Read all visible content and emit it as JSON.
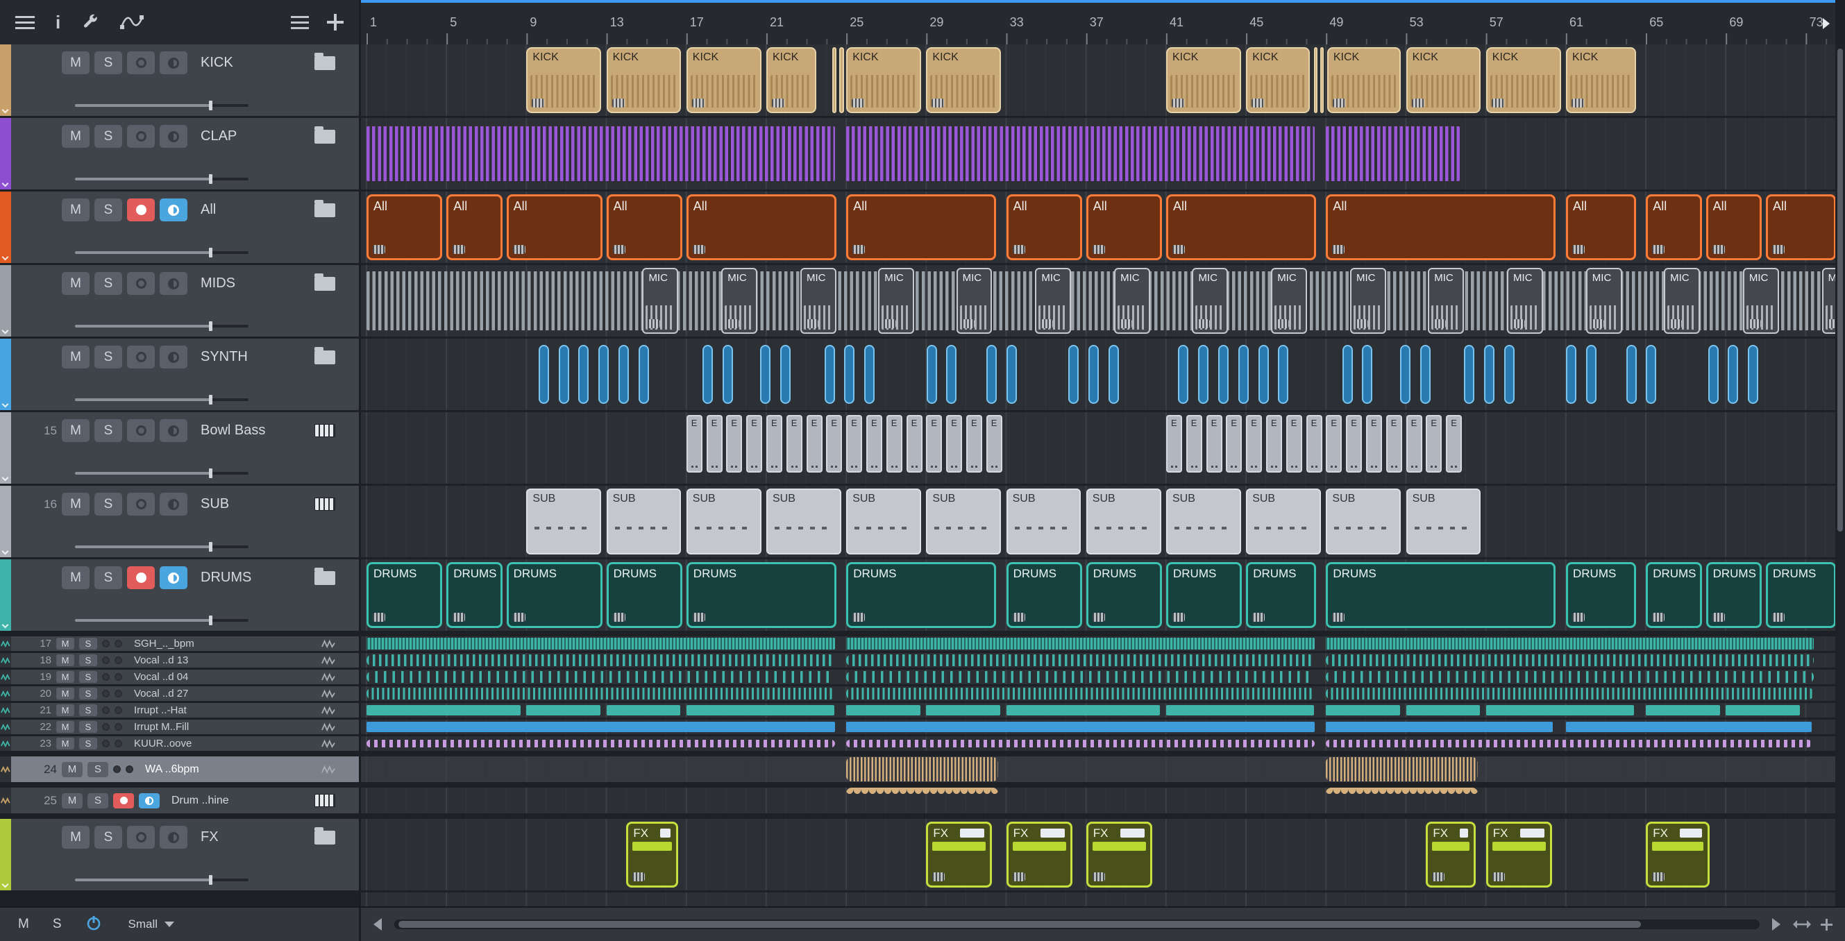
{
  "ui": {
    "mute": "M",
    "solo": "S"
  },
  "toolbar": {
    "info_label": "i",
    "icons": [
      "menu-icon",
      "info-icon",
      "wrench-icon",
      "automation-icon"
    ],
    "right_icons": [
      "track-list-icon",
      "add-track-icon"
    ]
  },
  "ruler": {
    "labels": [
      1,
      5,
      9,
      13,
      17,
      21,
      25,
      29,
      33,
      37,
      41,
      45,
      49,
      53,
      57,
      61,
      65,
      69,
      73
    ]
  },
  "bottom": {
    "size_label": "Small"
  },
  "rows": [
    {
      "id": "kick",
      "kind": "lg",
      "strip": "#c7a169",
      "num": "",
      "name": "KICK",
      "icon": "folder",
      "rec": false,
      "mon": false,
      "slider": 0.78,
      "clips": [
        {
          "style": "kick",
          "label": "KICK",
          "s": 9,
          "e": 12.85
        },
        {
          "style": "kick",
          "label": "KICK",
          "s": 13,
          "e": 16.85
        },
        {
          "style": "kick",
          "label": "KICK",
          "s": 17,
          "e": 20.85
        },
        {
          "style": "kick",
          "label": "KICK",
          "s": 21,
          "e": 23.6
        },
        {
          "style": "kick",
          "s": 24.3,
          "e": 24.62
        },
        {
          "style": "kick",
          "s": 24.66,
          "e": 24.98
        },
        {
          "style": "kick",
          "label": "KICK",
          "s": 25,
          "e": 28.85
        },
        {
          "style": "kick",
          "label": "KICK",
          "s": 29,
          "e": 32.85
        },
        {
          "style": "kick",
          "label": "KICK",
          "s": 41,
          "e": 44.85
        },
        {
          "style": "kick",
          "label": "KICK",
          "s": 45,
          "e": 48.3
        },
        {
          "style": "kick",
          "s": 48.38,
          "e": 48.66
        },
        {
          "style": "kick",
          "s": 48.7,
          "e": 48.98
        },
        {
          "style": "kick",
          "label": "KICK",
          "s": 49.05,
          "e": 52.85
        },
        {
          "style": "kick",
          "label": "KICK",
          "s": 53,
          "e": 56.85
        },
        {
          "style": "kick",
          "label": "KICK",
          "s": 57,
          "e": 60.85
        },
        {
          "style": "kick",
          "label": "KICK",
          "s": 61,
          "e": 64.6
        }
      ]
    },
    {
      "id": "clap",
      "kind": "lg",
      "strip": "#8d4fd0",
      "num": "",
      "name": "CLAP",
      "icon": "folder",
      "rec": false,
      "mon": false,
      "slider": 0.78,
      "clips": [
        {
          "style": "clap",
          "s": 1,
          "e": 24.55
        },
        {
          "style": "clap",
          "s": 25,
          "e": 48.55
        },
        {
          "style": "clap",
          "s": 49,
          "e": 55.8
        }
      ]
    },
    {
      "id": "all",
      "kind": "lg",
      "strip": "#e05a22",
      "num": "",
      "name": "All",
      "icon": "folder",
      "rec": true,
      "mon": true,
      "slider": 0.78,
      "clips": [
        {
          "style": "all",
          "label": "All",
          "s": 1,
          "e": 4.9
        },
        {
          "style": "all",
          "label": "All",
          "s": 5,
          "e": 7.9
        },
        {
          "style": "all",
          "label": "All",
          "s": 8,
          "e": 12.9
        },
        {
          "style": "all",
          "label": "All",
          "s": 13,
          "e": 16.9
        },
        {
          "style": "all",
          "label": "All",
          "s": 17,
          "e": 24.6
        },
        {
          "style": "all",
          "label": "All",
          "s": 25,
          "e": 32.6
        },
        {
          "style": "all",
          "label": "All",
          "s": 33,
          "e": 36.9
        },
        {
          "style": "all",
          "label": "All",
          "s": 37,
          "e": 40.9
        },
        {
          "style": "all",
          "label": "All",
          "s": 41,
          "e": 48.6
        },
        {
          "style": "all",
          "label": "All",
          "s": 49,
          "e": 60.6
        },
        {
          "style": "all",
          "label": "All",
          "s": 61,
          "e": 64.6
        },
        {
          "style": "all",
          "label": "All",
          "s": 65,
          "e": 67.9
        },
        {
          "style": "all",
          "label": "All",
          "s": 68,
          "e": 70.9
        },
        {
          "style": "all",
          "label": "All",
          "s": 71,
          "e": 74.6
        }
      ]
    },
    {
      "id": "mids",
      "kind": "lg",
      "strip": "#9aa0a8",
      "num": "",
      "name": "MIDS",
      "icon": "folder",
      "rec": false,
      "mon": false,
      "slider": 0.78,
      "clips": [
        {
          "style": "mids",
          "s": 1,
          "e": 74.4
        },
        {
          "style": "mic",
          "label": "MIC",
          "s": 14.8,
          "e": 16.7
        },
        {
          "style": "mic",
          "label": "MIC",
          "s": 18.75,
          "e": 20.65
        },
        {
          "style": "mic",
          "label": "MIC",
          "s": 22.7,
          "e": 24.6
        },
        {
          "style": "mic",
          "label": "MIC",
          "s": 26.6,
          "e": 28.5
        },
        {
          "style": "mic",
          "label": "MIC",
          "s": 30.5,
          "e": 32.4
        },
        {
          "style": "mic",
          "label": "MIC",
          "s": 34.45,
          "e": 36.35
        },
        {
          "style": "mic",
          "label": "MIC",
          "s": 38.4,
          "e": 40.3
        },
        {
          "style": "mic",
          "label": "MIC",
          "s": 42.3,
          "e": 44.2
        },
        {
          "style": "mic",
          "label": "MIC",
          "s": 46.25,
          "e": 48.15
        },
        {
          "style": "mic",
          "label": "MIC",
          "s": 50.2,
          "e": 52.1
        },
        {
          "style": "mic",
          "label": "MIC",
          "s": 54.1,
          "e": 56
        },
        {
          "style": "mic",
          "label": "MIC",
          "s": 58.05,
          "e": 59.95
        },
        {
          "style": "mic",
          "label": "MIC",
          "s": 62,
          "e": 63.9
        },
        {
          "style": "mic",
          "label": "MIC",
          "s": 65.9,
          "e": 67.8
        },
        {
          "style": "mic",
          "label": "MIC",
          "s": 69.85,
          "e": 71.75
        },
        {
          "style": "mic",
          "label": "MIC",
          "s": 73.8,
          "e": 75.7
        }
      ]
    },
    {
      "id": "synth",
      "kind": "lg",
      "strip": "#47a4e0",
      "num": "",
      "name": "SYNTH",
      "icon": "folder",
      "rec": false,
      "mon": false,
      "slider": 0.78,
      "pills": [
        9.5,
        10.5,
        11.5,
        12.5,
        13.5,
        14.5,
        17.7,
        18.7,
        20.6,
        21.6,
        23.8,
        24.8,
        25.8,
        28.9,
        29.9,
        31.9,
        32.9,
        36,
        37,
        38,
        41.5,
        42.5,
        43.5,
        44.5,
        45.5,
        46.5,
        49.7,
        50.7,
        52.6,
        53.6,
        55.8,
        56.8,
        57.8,
        60.9,
        61.9,
        63.9,
        64.9,
        68,
        69,
        70
      ],
      "clips": []
    },
    {
      "id": "bowl-bass",
      "kind": "lg",
      "strip": "#a9aeb6",
      "num": "15",
      "name": "Bowl Bass",
      "icon": "keys",
      "rec": false,
      "mon": false,
      "slider": 0.78,
      "clips": [
        {
          "style": "bassrun",
          "label": "E",
          "s": 17,
          "n": 16
        },
        {
          "style": "bassrun",
          "label": "E",
          "s": 41,
          "n": 15
        }
      ]
    },
    {
      "id": "sub",
      "kind": "lg",
      "strip": "#a9aeb6",
      "num": "16",
      "name": "SUB",
      "icon": "keys",
      "rec": false,
      "mon": false,
      "slider": 0.78,
      "clips": [
        {
          "style": "sub",
          "label": "SUB",
          "s": 9,
          "e": 12.85
        },
        {
          "style": "sub",
          "label": "SUB",
          "s": 13,
          "e": 16.85
        },
        {
          "style": "sub",
          "label": "SUB",
          "s": 17,
          "e": 20.85
        },
        {
          "style": "sub",
          "label": "SUB",
          "s": 21,
          "e": 24.85
        },
        {
          "style": "sub",
          "label": "SUB",
          "s": 25,
          "e": 28.85
        },
        {
          "style": "sub",
          "label": "SUB",
          "s": 29,
          "e": 32.85
        },
        {
          "style": "sub",
          "label": "SUB",
          "s": 33,
          "e": 36.85
        },
        {
          "style": "sub",
          "label": "SUB",
          "s": 37,
          "e": 40.85
        },
        {
          "style": "sub",
          "label": "SUB",
          "s": 41,
          "e": 44.85
        },
        {
          "style": "sub",
          "label": "SUB",
          "s": 45,
          "e": 48.85
        },
        {
          "style": "sub",
          "label": "SUB",
          "s": 49,
          "e": 52.85
        },
        {
          "style": "sub",
          "label": "SUB",
          "s": 53,
          "e": 56.85
        }
      ]
    },
    {
      "id": "drums",
      "kind": "lg",
      "strip": "#3fb3a9",
      "num": "",
      "name": "DRUMS",
      "icon": "folder",
      "rec": true,
      "mon": true,
      "slider": 0.78,
      "clips": [
        {
          "style": "drums",
          "label": "DRUMS",
          "s": 1,
          "e": 4.9
        },
        {
          "style": "drums",
          "label": "DRUMS",
          "s": 5,
          "e": 7.9
        },
        {
          "style": "drums",
          "label": "DRUMS",
          "s": 8,
          "e": 12.9
        },
        {
          "style": "drums",
          "label": "DRUMS",
          "s": 13,
          "e": 16.9
        },
        {
          "style": "drums",
          "label": "DRUMS",
          "s": 17,
          "e": 24.6
        },
        {
          "style": "drums",
          "label": "DRUMS",
          "s": 25,
          "e": 32.6
        },
        {
          "style": "drums",
          "label": "DRUMS",
          "s": 33,
          "e": 36.9
        },
        {
          "style": "drums",
          "label": "DRUMS",
          "s": 37,
          "e": 40.9
        },
        {
          "style": "drums",
          "label": "DRUMS",
          "s": 41,
          "e": 44.9
        },
        {
          "style": "drums",
          "label": "DRUMS",
          "s": 45,
          "e": 48.6
        },
        {
          "style": "drums",
          "label": "DRUMS",
          "s": 49,
          "e": 60.6
        },
        {
          "style": "drums",
          "label": "DRUMS",
          "s": 61,
          "e": 64.6
        },
        {
          "style": "drums",
          "label": "DRUMS",
          "s": 65,
          "e": 67.9
        },
        {
          "style": "drums",
          "label": "DRUMS",
          "s": 68,
          "e": 70.9
        },
        {
          "style": "drums",
          "label": "DRUMS",
          "s": 71,
          "e": 74.6
        }
      ]
    },
    {
      "id": "t17",
      "kind": "sm",
      "gap": true,
      "strip": "#3fb3a9",
      "num": "17",
      "name": "SGH_.._bpm",
      "icon": "wave",
      "clips": [
        {
          "style": "dense",
          "s": 1,
          "e": 24.55
        },
        {
          "style": "dense",
          "s": 25,
          "e": 48.55
        },
        {
          "style": "dense",
          "s": 49,
          "e": 73.5
        }
      ]
    },
    {
      "id": "t18",
      "kind": "sm",
      "strip": "#3fb3a9",
      "num": "18",
      "name": "Vocal ..d 13",
      "icon": "wave",
      "clips": [
        {
          "style": "vox1",
          "s": 1,
          "e": 24.55
        },
        {
          "style": "vox1",
          "s": 25,
          "e": 48.55
        },
        {
          "style": "vox1",
          "s": 49,
          "e": 73.5
        }
      ]
    },
    {
      "id": "t19",
      "kind": "sm",
      "strip": "#3fb3a9",
      "num": "19",
      "name": "Vocal ..d 04",
      "icon": "wave",
      "clips": [
        {
          "style": "vox2",
          "s": 1,
          "e": 24.55
        },
        {
          "style": "vox2",
          "s": 25,
          "e": 48.55
        },
        {
          "style": "vox2",
          "s": 49,
          "e": 73.5
        }
      ]
    },
    {
      "id": "t20",
      "kind": "sm",
      "strip": "#3fb3a9",
      "num": "20",
      "name": "Vocal ..d 27",
      "icon": "wave",
      "clips": [
        {
          "style": "vox3",
          "s": 1,
          "e": 24.55
        },
        {
          "style": "vox3",
          "s": 25,
          "e": 48.55
        },
        {
          "style": "vox3",
          "s": 49,
          "e": 73.5
        }
      ]
    },
    {
      "id": "t21",
      "kind": "sm",
      "strip": "#3fb3a9",
      "num": "21",
      "name": "Irrupt ..-Hat",
      "icon": "wave",
      "clips": [
        {
          "style": "hat",
          "s": 1,
          "e": 8.8
        },
        {
          "style": "hat",
          "s": 9,
          "e": 12.8
        },
        {
          "style": "hat",
          "s": 13,
          "e": 16.8
        },
        {
          "style": "hat",
          "s": 17,
          "e": 24.5
        },
        {
          "style": "hat",
          "s": 25,
          "e": 28.8
        },
        {
          "style": "hat",
          "s": 29,
          "e": 32.8
        },
        {
          "style": "hat",
          "s": 33,
          "e": 40.8
        },
        {
          "style": "hat",
          "s": 41,
          "e": 48.5
        },
        {
          "style": "hat",
          "s": 49,
          "e": 52.8
        },
        {
          "style": "hat",
          "s": 53,
          "e": 56.8
        },
        {
          "style": "hat",
          "s": 57,
          "e": 64.5
        },
        {
          "style": "hat",
          "s": 65,
          "e": 68.8
        },
        {
          "style": "hat",
          "s": 69,
          "e": 72.8
        }
      ]
    },
    {
      "id": "t22",
      "kind": "sm",
      "strip": "#3fb3a9",
      "num": "22",
      "name": "Irrupt M..Fill",
      "icon": "wave",
      "clips": [
        {
          "style": "fill",
          "s": 1,
          "e": 24.55
        },
        {
          "style": "fill",
          "s": 25,
          "e": 48.55
        },
        {
          "style": "fill",
          "s": 49,
          "e": 60.45
        },
        {
          "style": "fill",
          "s": 61,
          "e": 73.4
        }
      ]
    },
    {
      "id": "t23",
      "kind": "sm",
      "strip": "#3fb3a9",
      "num": "23",
      "name": "KUUR..oove",
      "icon": "wave",
      "clips": [
        {
          "style": "groove",
          "s": 1,
          "e": 24.55
        },
        {
          "style": "groove",
          "s": 25,
          "e": 48.55
        },
        {
          "style": "groove",
          "s": 49,
          "e": 73.4
        }
      ]
    },
    {
      "id": "t24",
      "kind": "md",
      "gap": true,
      "selected": true,
      "strip": "#c7a169",
      "num": "24",
      "name": "WA ..6bpm",
      "icon": "wave",
      "clips": [
        {
          "style": "wavetan",
          "s": 25,
          "e": 32.7
        },
        {
          "style": "wavetan",
          "s": 49,
          "e": 56.7
        }
      ]
    },
    {
      "id": "t25",
      "kind": "md",
      "gap": true,
      "strip": "#c7a169",
      "num": "25",
      "name": "Drum ..hine",
      "icon": "keys",
      "rec": true,
      "mon": true,
      "clips": [
        {
          "style": "arctan",
          "s": 25,
          "e": 32.7
        },
        {
          "style": "arctan",
          "s": 49,
          "e": 56.7
        }
      ]
    },
    {
      "id": "fx",
      "kind": "lg",
      "gap": true,
      "strip": "#aec93c",
      "num": "",
      "name": "FX",
      "icon": "folder",
      "rec": false,
      "mon": false,
      "slider": 0.78,
      "clips": [
        {
          "style": "fx",
          "label": "FX",
          "s": 14,
          "e": 16.7
        },
        {
          "style": "fx",
          "label": "FX",
          "s": 29,
          "e": 32.4
        },
        {
          "style": "fx",
          "label": "FX",
          "s": 33,
          "e": 36.4
        },
        {
          "style": "fx",
          "label": "FX",
          "s": 37,
          "e": 40.4
        },
        {
          "style": "fx",
          "label": "FX",
          "s": 54,
          "e": 56.6
        },
        {
          "style": "fx",
          "label": "FX",
          "s": 57,
          "e": 60.4
        },
        {
          "style": "fx",
          "label": "FX",
          "s": 65,
          "e": 68.3
        }
      ]
    }
  ],
  "colors": {
    "app_bg": "#1d2024",
    "toolbar_bg": "#26292e",
    "panel_row": "#3f444b",
    "lane_bg": "#2c2f34",
    "grid_minor": "#33363c",
    "grid_major": "#3c4046",
    "ruler_text": "#b6bac0",
    "accent_line": "#3e9af0",
    "btn_bg": "#5a6069",
    "btn_text": "#d2d6db",
    "rec_red": "#e25c5c",
    "mon_blue": "#4ba6e0",
    "name_text": "#d6dade",
    "num_text": "#9aa0a7",
    "kick_fill": "#c9a878",
    "kick_border": "#e8d2a8",
    "kick_stripe": "#9c7a46",
    "kick_text": "#2c2820",
    "clap": "#9a58d8",
    "all_fill": "#6e3012",
    "all_border": "#ff7c38",
    "all_text": "#f2ece6",
    "mids_stripe": "#9aa0a8",
    "mic_fill": "#44484e",
    "mic_border": "#c6cad0",
    "mic_text": "#eceef2",
    "synth_fill": "#2a7ab2",
    "synth_border": "#7cc4f0",
    "bass_fill": "#b2b7bf",
    "bass_border": "#d6dae0",
    "bass_text": "#2b2f35",
    "sub_fill": "#c4c8ce",
    "sub_border": "#dde1e6",
    "sub_text": "#2f343a",
    "sub_dash": "#5a5f66",
    "drums_fill": "#16413f",
    "drums_border": "#3cc2b0",
    "drums_text": "#ecf6f4",
    "teal": "#41b4aa",
    "blue_seg": "#3d9bdb",
    "purple_dash": "#c89ae0",
    "tan": "#d6b07c",
    "fx_fill": "#4a5019",
    "fx_border": "#c6de3e",
    "fx_band": "#b9d832",
    "fx_text": "#f0f4e2",
    "selected_row": "#7b818a",
    "chip_bg": "#c9cdd2",
    "chip_tick": "#42464c",
    "bottom_bg": "#33373d"
  }
}
